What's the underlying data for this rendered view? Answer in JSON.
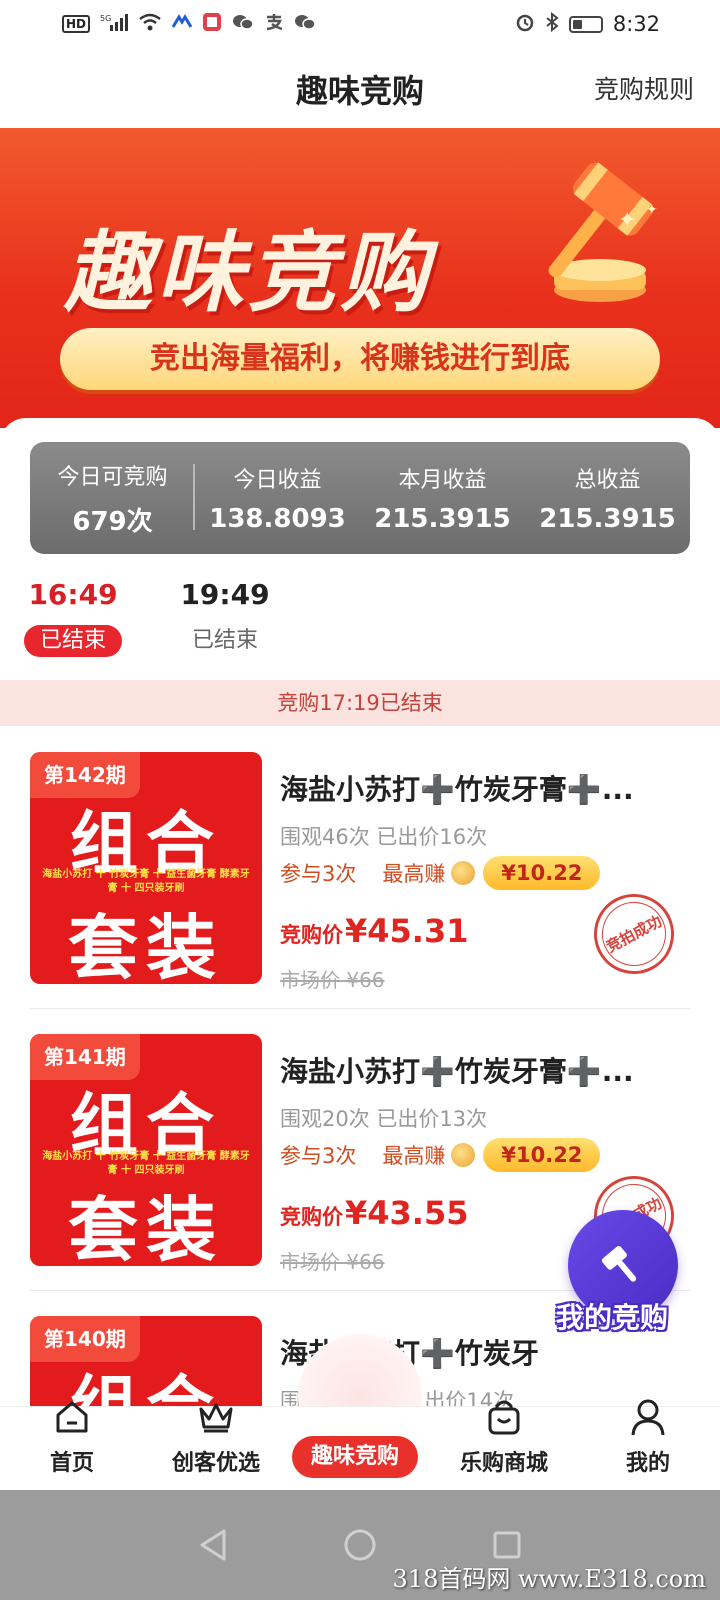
{
  "status_bar": {
    "left_badges": [
      "HD",
      "5G"
    ],
    "time": "8:32"
  },
  "header": {
    "title": "趣味竞购",
    "rules_link": "竞购规则"
  },
  "banner": {
    "title": "趣味竞购",
    "subtitle": "竞出海量福利，将赚钱进行到底"
  },
  "stats": [
    {
      "label": "今日可竞购",
      "value": "679次"
    },
    {
      "label": "今日收益",
      "value": "138.8093"
    },
    {
      "label": "本月收益",
      "value": "215.3915"
    },
    {
      "label": "总收益",
      "value": "215.3915"
    }
  ],
  "sessions": [
    {
      "time": "16:49",
      "status": "已结束",
      "active": true
    },
    {
      "time": "19:49",
      "status": "已结束",
      "active": false
    }
  ],
  "ended_notice": "竞购17:19已结束",
  "products": [
    {
      "period": "第142期",
      "thumb_top": "组合",
      "thumb_small": "海盐小苏打 十 竹炭牙膏 十 益生菌牙膏 酵素牙膏 十 四只装牙刷",
      "thumb_bottom": "套装",
      "title": "海盐小苏打➕竹炭牙膏➕...",
      "watch": "围观46次 已出价16次",
      "join": "参与3次",
      "max_earn_label": "最高赚",
      "max_earn": "¥10.22",
      "price_label": "竞购价",
      "price": "¥45.31",
      "market": "市场价 ¥66",
      "stamp": "竞拍成功"
    },
    {
      "period": "第141期",
      "thumb_top": "组合",
      "thumb_small": "海盐小苏打 十 竹炭牙膏 十 益生菌牙膏 酵素牙膏 十 四只装牙刷",
      "thumb_bottom": "套装",
      "title": "海盐小苏打➕竹炭牙膏➕...",
      "watch": "围观20次 已出价13次",
      "join": "参与3次",
      "max_earn_label": "最高赚",
      "max_earn": "¥10.22",
      "price_label": "竞购价",
      "price": "¥43.55",
      "market": "市场价 ¥66",
      "stamp": "竞拍成功"
    },
    {
      "period": "第140期",
      "thumb_top": "组合",
      "title": "海盐小苏打➕竹炭牙",
      "watch": "围",
      "watch_tail": "出价14次"
    }
  ],
  "fab": {
    "label": "我的竞购",
    "icon": "gavel-icon"
  },
  "tabs": [
    {
      "label": "首页",
      "icon": "home-icon"
    },
    {
      "label": "创客优选",
      "icon": "crown-icon"
    },
    {
      "label": "趣味竞购",
      "icon": "auction-icon",
      "active": true
    },
    {
      "label": "乐购商城",
      "icon": "shopping-bag-icon"
    },
    {
      "label": "我的",
      "icon": "user-icon"
    }
  ],
  "watermark": "318首码网 www.E318.com",
  "colors": {
    "brand_red": "#e8312b",
    "banner_red": "#e8311c",
    "stats_gray": "#7a7a7a",
    "fab_purple": "#5a3ad6"
  }
}
